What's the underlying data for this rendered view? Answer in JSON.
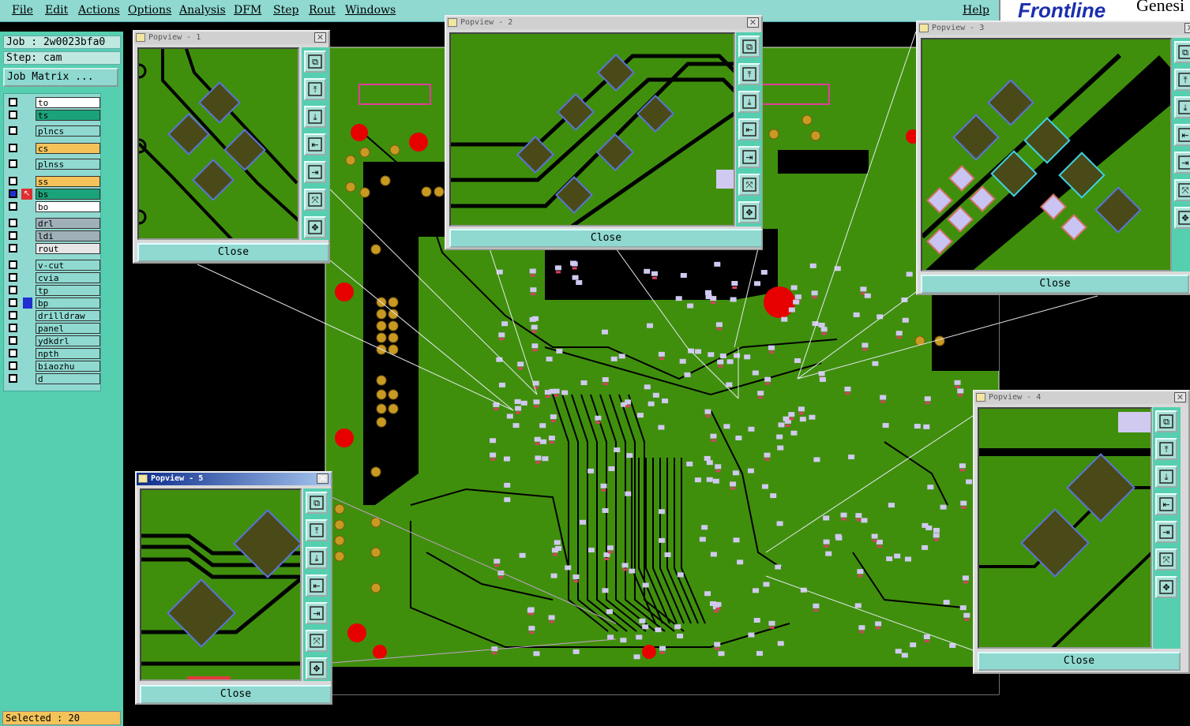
{
  "menu": [
    "File",
    "Edit",
    "Actions",
    "Options",
    "Analysis",
    "DFM",
    "Step",
    "Rout",
    "Windows"
  ],
  "help": "Help",
  "brand": {
    "logo": "Frontline",
    "product": "Genesi"
  },
  "job": {
    "label": "Job : 2w0023bfa0",
    "step": "Step: cam",
    "matrix_button": "Job Matrix ..."
  },
  "layers": [
    {
      "name": "to",
      "color": "#ffffff"
    },
    {
      "name": "ts",
      "color": "#1aa37a"
    },
    {
      "name": "plncs",
      "color": "#8fd9d0"
    },
    {
      "name": "cs",
      "color": "#f3c35a"
    },
    {
      "name": "plnss",
      "color": "#8fd9d0"
    },
    {
      "name": "ss",
      "color": "#f3c35a"
    },
    {
      "name": "bs",
      "color": "#1aa37a"
    },
    {
      "name": "bo",
      "color": "#ffffff"
    },
    {
      "name": "drl",
      "color": "#9fb0b8"
    },
    {
      "name": "ldi",
      "color": "#9fb0b8"
    },
    {
      "name": "rout",
      "color": "#e6e6e6"
    },
    {
      "name": "v-cut",
      "color": "#8fd9d0"
    },
    {
      "name": "cvia",
      "color": "#8fd9d0"
    },
    {
      "name": "tp",
      "color": "#8fd9d0"
    },
    {
      "name": "bp",
      "color": "#8fd9d0"
    },
    {
      "name": "drilldraw",
      "color": "#8fd9d0"
    },
    {
      "name": "panel",
      "color": "#8fd9d0"
    },
    {
      "name": "ydkdrl",
      "color": "#8fd9d0"
    },
    {
      "name": "npth",
      "color": "#8fd9d0"
    },
    {
      "name": "biaozhu",
      "color": "#8fd9d0"
    },
    {
      "name": "d",
      "color": "#8fd9d0"
    }
  ],
  "status": "Selected : 20",
  "popups": [
    {
      "title": "Popview - 1",
      "close": "Close"
    },
    {
      "title": "Popview - 2",
      "close": "Close"
    },
    {
      "title": "Popview - 3",
      "close": "Close"
    },
    {
      "title": "Popview - 4",
      "close": "Close"
    },
    {
      "title": "Popview - 5",
      "close": "Close"
    }
  ],
  "colors": {
    "board": "#3f8f0d",
    "pad": "#4a4a18",
    "pad_border": "#5a74d8",
    "accent": "#8fd9d0",
    "via": "#e60000"
  }
}
